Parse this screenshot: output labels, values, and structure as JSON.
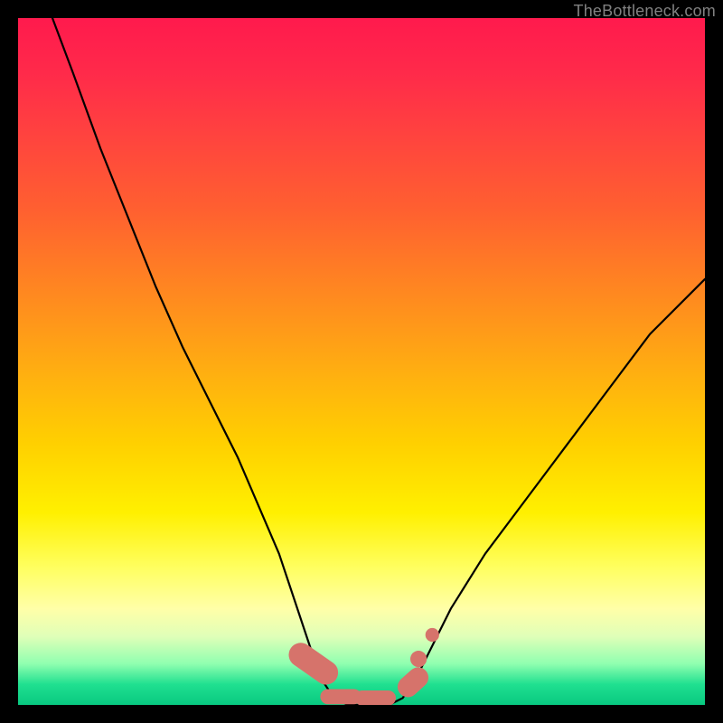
{
  "watermark": "TheBottleneck.com",
  "colors": {
    "frame": "#000000",
    "curve": "#000000",
    "markers_fill": "#d6736b",
    "markers_stroke": "#d6736b",
    "gradient_stops": [
      "#ff1a4d",
      "#ff2a4a",
      "#ff4040",
      "#ff6030",
      "#ff8820",
      "#ffb010",
      "#ffd000",
      "#fff000",
      "#ffff60",
      "#ffffa8",
      "#e0ffb8",
      "#90ffb0",
      "#20e090",
      "#08c880"
    ]
  },
  "chart_data": {
    "type": "line",
    "title": "",
    "xlabel": "",
    "ylabel": "",
    "xlim": [
      0,
      100
    ],
    "ylim": [
      0,
      100
    ],
    "grid": false,
    "legend": false,
    "note": "Values are read off the plotted V-shaped curve in percent of axis range. The curve drops from top-left to a flat minimum region around x≈44–56 near y≈0 then rises to the upper-right; the right branch ends near y≈62 at x=100.",
    "series": [
      {
        "name": "curve",
        "x": [
          5,
          8,
          12,
          16,
          20,
          24,
          28,
          32,
          35,
          38,
          40,
          42,
          44,
          46,
          48,
          50,
          52,
          54,
          56,
          58,
          60,
          63,
          68,
          74,
          80,
          86,
          92,
          100
        ],
        "y": [
          100,
          92,
          81,
          71,
          61,
          52,
          44,
          36,
          29,
          22,
          16,
          10,
          4,
          1,
          0,
          0,
          0,
          0,
          1,
          4,
          8,
          14,
          22,
          30,
          38,
          46,
          54,
          62
        ]
      }
    ],
    "markers": {
      "note": "Pink sausage shapes along the valley/low region of the curve; coordinates in percent.",
      "points": [
        {
          "x": 43,
          "y": 6,
          "w": 3.5,
          "h": 8,
          "rot": -55
        },
        {
          "x": 47,
          "y": 1.2,
          "w": 6,
          "h": 2.2,
          "rot": 0
        },
        {
          "x": 52,
          "y": 1.0,
          "w": 6,
          "h": 2.2,
          "rot": 0
        },
        {
          "x": 57.5,
          "y": 3.3,
          "w": 3.0,
          "h": 5.0,
          "rot": 48
        },
        {
          "x": 58.3,
          "y": 6.7,
          "w": 2.4,
          "h": 2.4,
          "rot": 0
        },
        {
          "x": 60.3,
          "y": 10.2,
          "w": 2.0,
          "h": 2.0,
          "rot": 0
        }
      ]
    }
  }
}
